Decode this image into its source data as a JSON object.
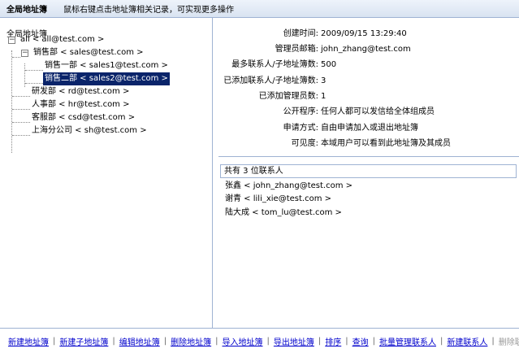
{
  "header": {
    "title": "全局地址簿",
    "hint": "鼠标右键点击地址簿相关记录，可实现更多操作"
  },
  "tree": {
    "title": "全局地址簿",
    "nodes": [
      {
        "label": "all < all@test.com >",
        "toggle": "−"
      },
      {
        "label": "销售部 < sales@test.com >",
        "toggle": "−"
      },
      {
        "label": "销售一部 < sales1@test.com >"
      },
      {
        "label": "销售二部 < sales2@test.com >",
        "selected": true
      },
      {
        "label": "研发部 < rd@test.com >"
      },
      {
        "label": "人事部 < hr@test.com >"
      },
      {
        "label": "客服部 < csd@test.com >"
      },
      {
        "label": "上海分公司 < sh@test.com >"
      }
    ]
  },
  "details": [
    {
      "label": "创建时间:",
      "value": "2009/09/15 13:29:40"
    },
    {
      "label": "管理员邮箱:",
      "value": "john_zhang@test.com"
    },
    {
      "label": "最多联系人/子地址簿数:",
      "value": "500"
    },
    {
      "label": "已添加联系人/子地址簿数:",
      "value": "3"
    },
    {
      "label": "已添加管理员数:",
      "value": "1"
    },
    {
      "label": "公开程序:",
      "value": "任何人都可以发信给全体组成员"
    },
    {
      "label": "申请方式:",
      "value": "自由申请加入或退出地址簿"
    },
    {
      "label": "可见度:",
      "value": "本域用户可以看到此地址簿及其成员"
    }
  ],
  "contacts": {
    "summary": "共有 3 位联系人",
    "items": [
      "张鑫 < john_zhang@test.com >",
      "谢青 < lili_xie@test.com >",
      "陆大成 < tom_lu@test.com >"
    ]
  },
  "footer": {
    "actions": [
      "新建地址簿",
      "新建子地址簿",
      "编辑地址簿",
      "删除地址簿",
      "导入地址簿",
      "导出地址簿",
      "排序",
      "查询",
      "批量管理联系人",
      "新建联系人"
    ],
    "disabled_action": "删除联系人"
  },
  "colors": {
    "selected_bg": "#0a246a",
    "border": "#9fb3d3",
    "link": "#0000cc"
  }
}
